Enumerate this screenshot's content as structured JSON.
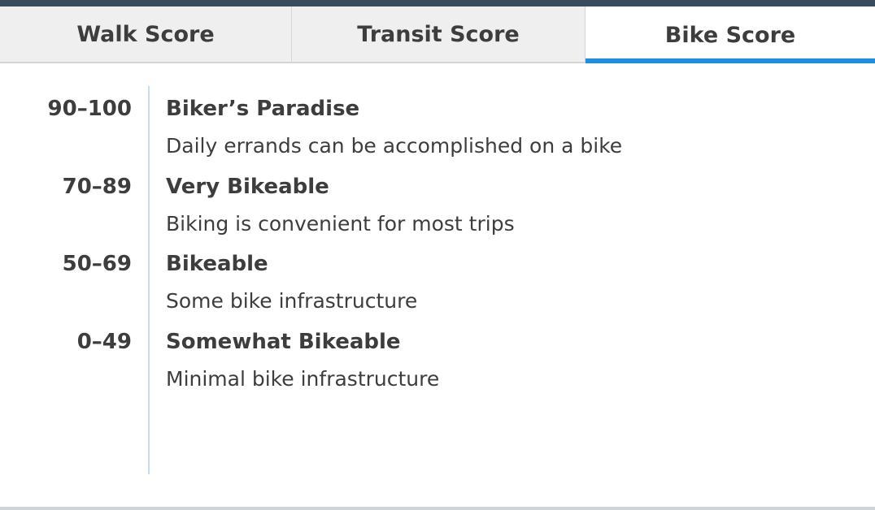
{
  "tabs": [
    {
      "label": "Walk Score",
      "active": false
    },
    {
      "label": "Transit Score",
      "active": false
    },
    {
      "label": "Bike Score",
      "active": true
    }
  ],
  "accent_color": "#1a8fe3",
  "scores": [
    {
      "range": "90–100",
      "label": "Biker’s Paradise",
      "description": "Daily errands can be accomplished on a bike"
    },
    {
      "range": "70–89",
      "label": "Very Bikeable",
      "description": "Biking is convenient for most trips"
    },
    {
      "range": "50–69",
      "label": "Bikeable",
      "description": "Some bike infrastructure"
    },
    {
      "range": "0–49",
      "label": "Somewhat Bikeable",
      "description": "Minimal bike infrastructure"
    }
  ]
}
